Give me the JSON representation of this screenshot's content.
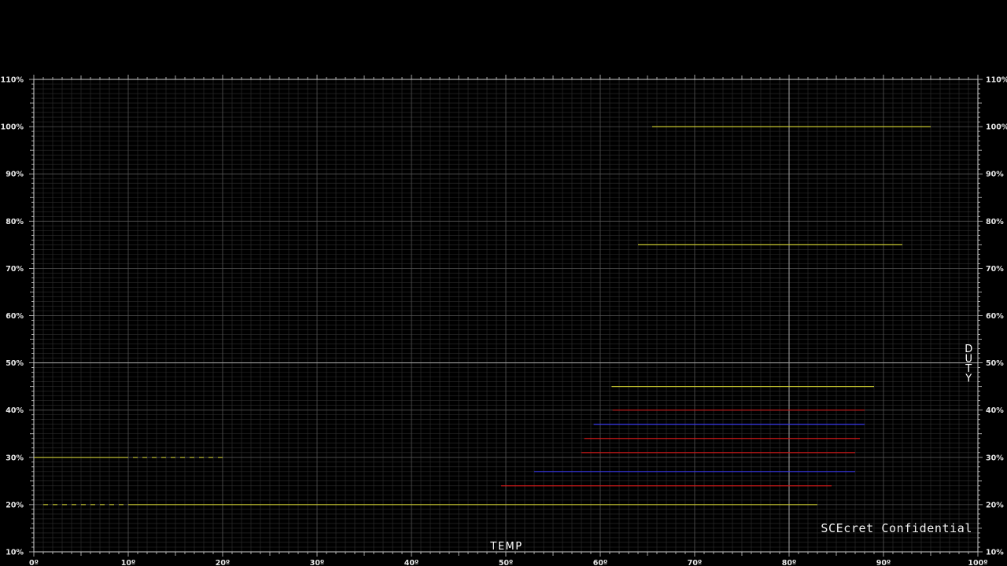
{
  "chart_data": {
    "type": "line",
    "xlabel": "TEMP",
    "ylabel": "DUTY",
    "watermark": "SCEcret Confidential",
    "xlim": [
      0,
      100
    ],
    "ylim": [
      10,
      110
    ],
    "x_ticks": [
      {
        "value": 0,
        "label": "0º"
      },
      {
        "value": 10,
        "label": "10º"
      },
      {
        "value": 20,
        "label": "20º"
      },
      {
        "value": 30,
        "label": "30º"
      },
      {
        "value": 40,
        "label": "40º"
      },
      {
        "value": 50,
        "label": "50º"
      },
      {
        "value": 60,
        "label": "60º"
      },
      {
        "value": 70,
        "label": "70º"
      },
      {
        "value": 80,
        "label": "80º"
      },
      {
        "value": 90,
        "label": "90º"
      },
      {
        "value": 100,
        "label": "100º"
      }
    ],
    "y_ticks": [
      {
        "value": 10,
        "label": "10%"
      },
      {
        "value": 20,
        "label": "20%"
      },
      {
        "value": 30,
        "label": "30%"
      },
      {
        "value": 40,
        "label": "40%"
      },
      {
        "value": 50,
        "label": "50%"
      },
      {
        "value": 60,
        "label": "60%"
      },
      {
        "value": 70,
        "label": "70%"
      },
      {
        "value": 80,
        "label": "80%"
      },
      {
        "value": 90,
        "label": "90%"
      },
      {
        "value": 100,
        "label": "100%"
      },
      {
        "value": 110,
        "label": "110%"
      }
    ],
    "grid": true,
    "highlight_lines": {
      "x": 80,
      "y": 50
    },
    "series": [
      {
        "color": "#c8c832",
        "style": "solid",
        "x": [
          65.5,
          95.0
        ],
        "y": [
          100,
          100
        ]
      },
      {
        "color": "#c8c832",
        "style": "solid",
        "x": [
          64.0,
          92.0
        ],
        "y": [
          75,
          75
        ]
      },
      {
        "color": "#c8c832",
        "style": "solid",
        "x": [
          61.2,
          89.0
        ],
        "y": [
          45,
          45
        ]
      },
      {
        "color": "#cc1a1a",
        "style": "solid",
        "x": [
          61.3,
          88.0
        ],
        "y": [
          40,
          40
        ]
      },
      {
        "color": "#3a3aee",
        "style": "solid",
        "x": [
          59.3,
          88.0
        ],
        "y": [
          37,
          37
        ]
      },
      {
        "color": "#cc1a1a",
        "style": "solid",
        "x": [
          58.3,
          87.5
        ],
        "y": [
          34,
          34
        ]
      },
      {
        "color": "#cc1a1a",
        "style": "solid",
        "x": [
          58.0,
          87.0
        ],
        "y": [
          31,
          31
        ]
      },
      {
        "color": "#3a3aee",
        "style": "solid",
        "x": [
          53.0,
          87.0
        ],
        "y": [
          27,
          27
        ]
      },
      {
        "color": "#cc1a1a",
        "style": "solid",
        "x": [
          49.5,
          84.5
        ],
        "y": [
          24,
          24
        ]
      },
      {
        "color": "#c8c832",
        "style": "solid",
        "x": [
          0.0,
          10.0
        ],
        "y": [
          30,
          30
        ]
      },
      {
        "color": "#c8c832",
        "style": "dashed",
        "x": [
          10.5,
          20.0
        ],
        "y": [
          30,
          30
        ]
      },
      {
        "color": "#c8c832",
        "style": "dashed",
        "x": [
          1.0,
          10.0
        ],
        "y": [
          20,
          20
        ]
      },
      {
        "color": "#c8c832",
        "style": "solid",
        "x": [
          10.0,
          83.0
        ],
        "y": [
          20,
          20
        ]
      }
    ]
  }
}
